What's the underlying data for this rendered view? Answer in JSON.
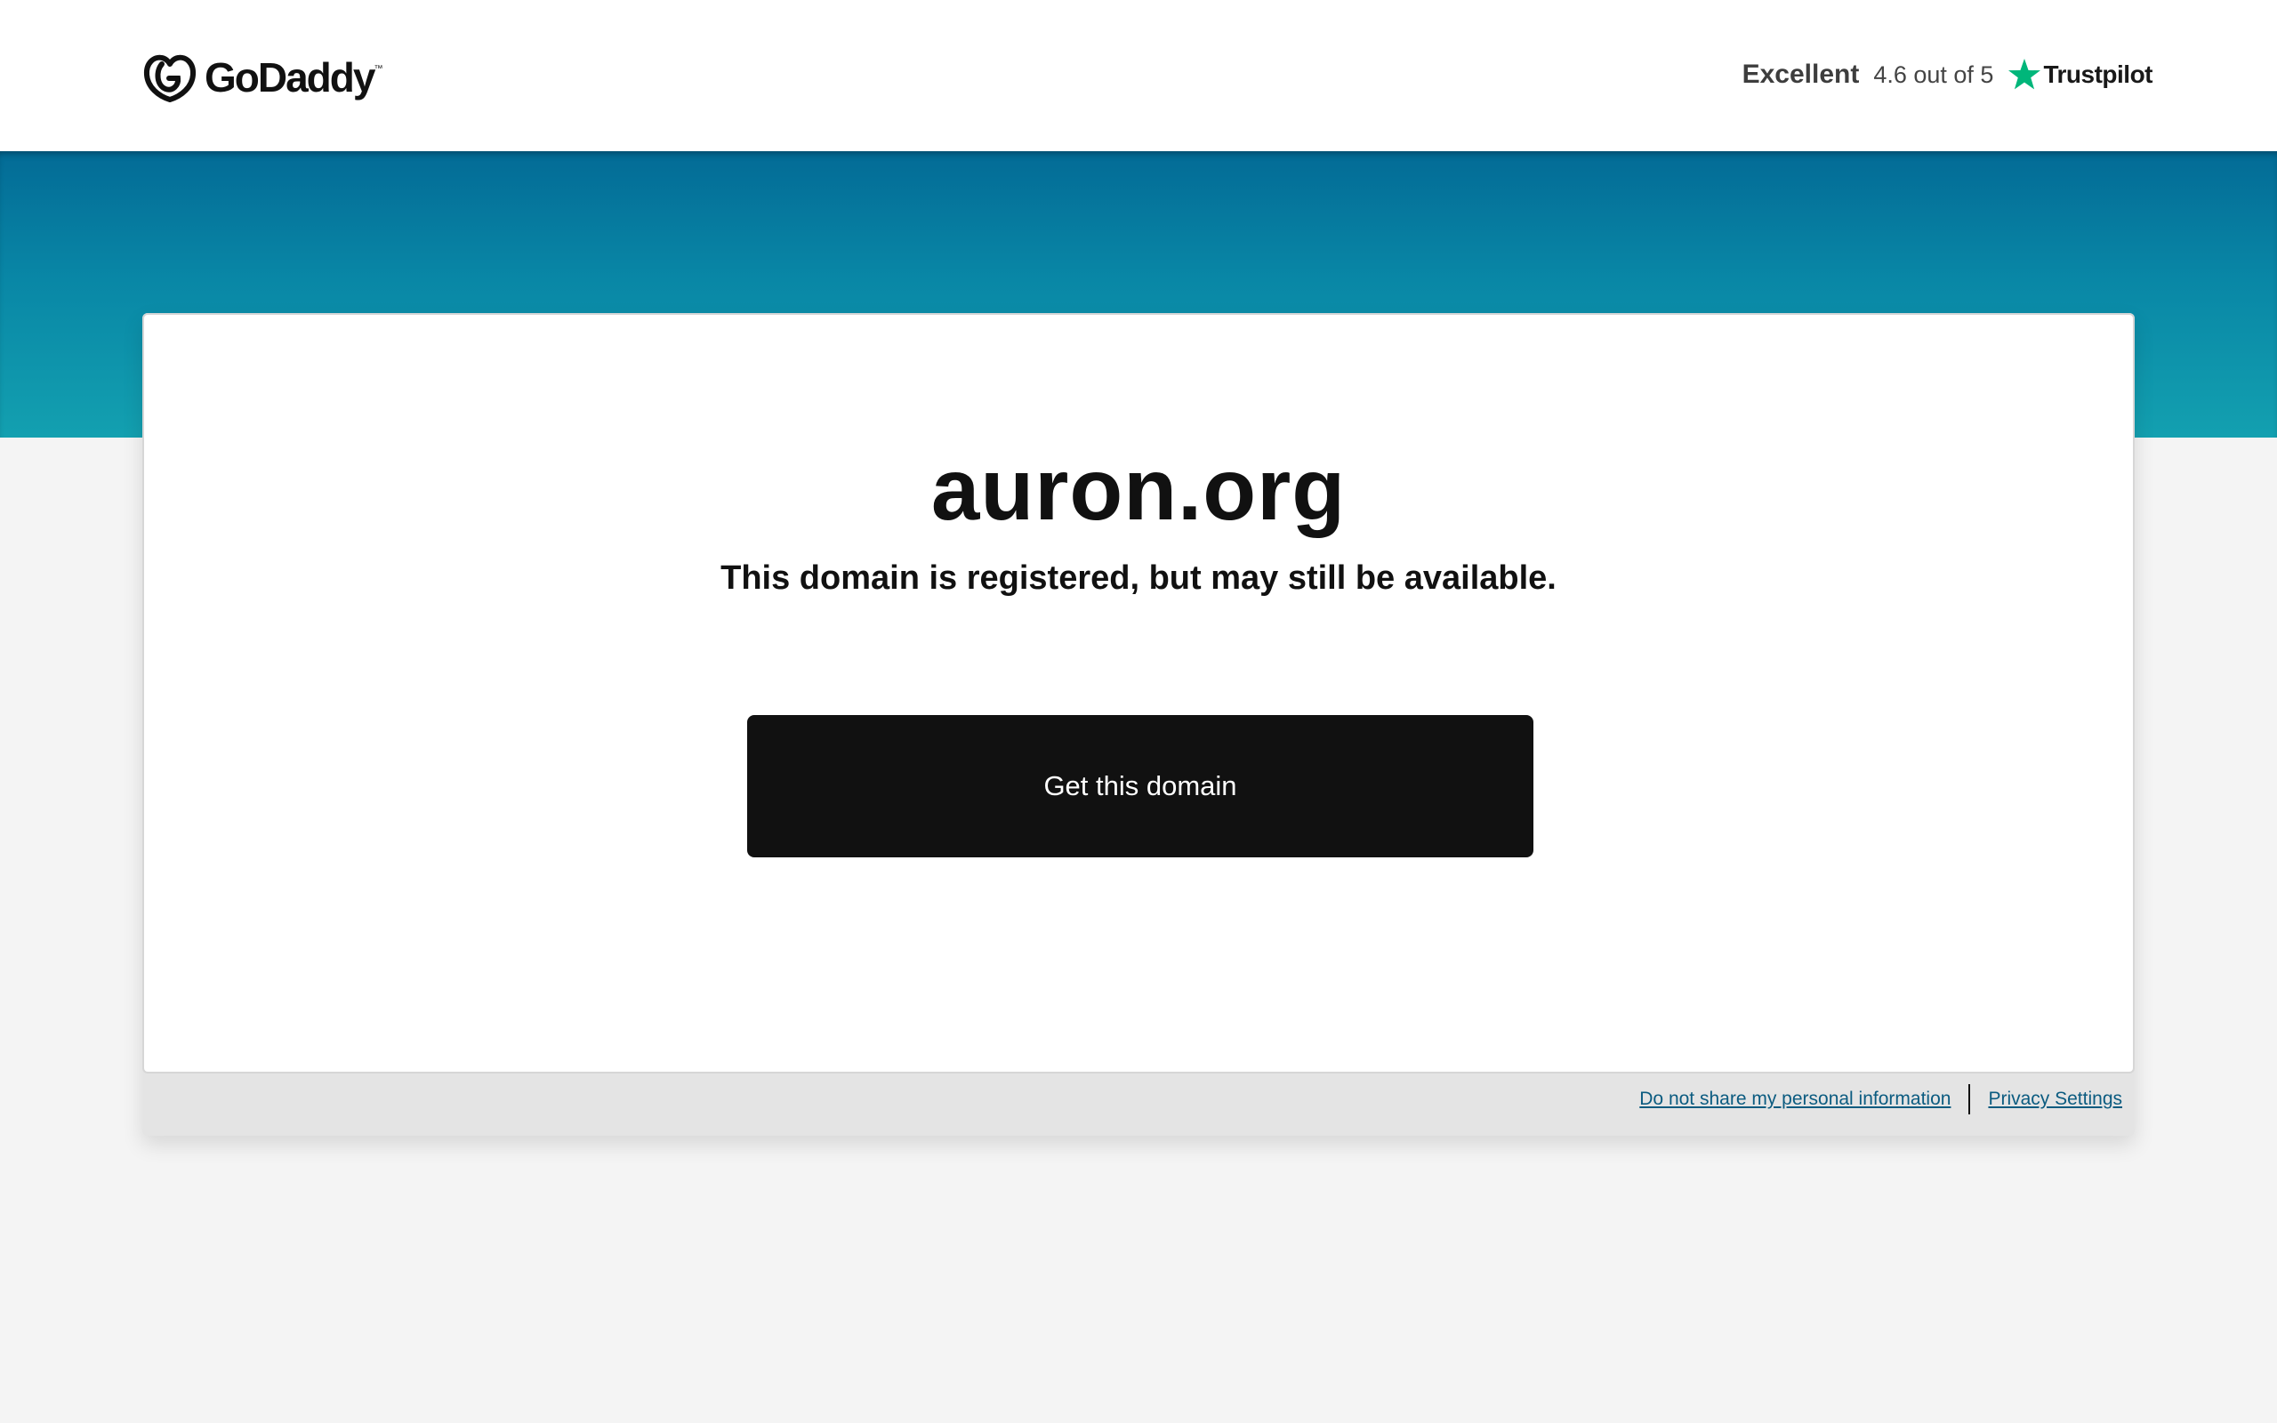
{
  "header": {
    "logo_text": "GoDaddy",
    "logo_tm": "™",
    "rating": {
      "label": "Excellent",
      "score": "4.6 out of 5",
      "provider": "Trustpilot",
      "star_icon": "star-icon",
      "star_color": "#00b67a"
    }
  },
  "main": {
    "domain": "auron.org",
    "status": "This domain is registered, but may still be available.",
    "cta_label": "Get this domain"
  },
  "footer": {
    "links": [
      {
        "label": "Do not share my personal information"
      },
      {
        "label": "Privacy Settings"
      }
    ]
  },
  "colors": {
    "band_top": "#036b96",
    "band_bottom": "#13a0b0",
    "button": "#111111",
    "link": "#0b5b80"
  }
}
